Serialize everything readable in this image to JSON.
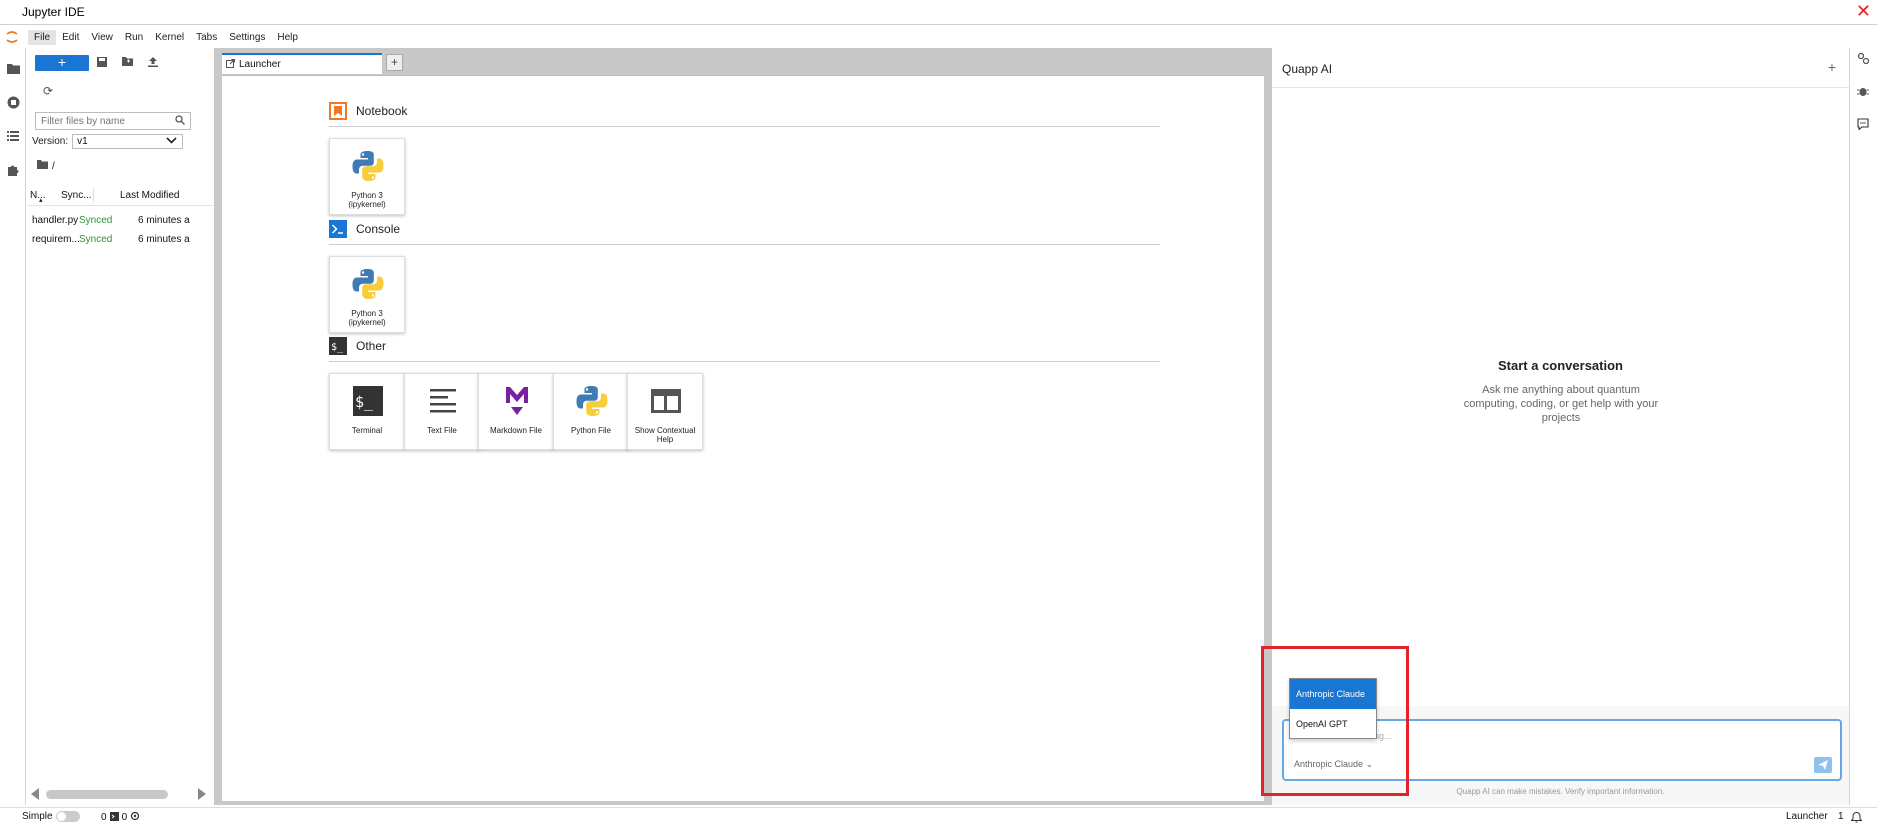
{
  "window": {
    "title": "Jupyter IDE"
  },
  "menu": [
    "File",
    "Edit",
    "View",
    "Run",
    "Kernel",
    "Tabs",
    "Settings",
    "Help"
  ],
  "filebrowser": {
    "new_label": "+",
    "filter_placeholder": "Filter files by name",
    "version_label": "Version:",
    "version_value": "v1",
    "path": "/",
    "columns": {
      "name": "N...",
      "sync": "Sync...",
      "modified": "Last Modified"
    },
    "files": [
      {
        "name": "handler.py",
        "sync": "Synced",
        "modified": "6 minutes a"
      },
      {
        "name": "requirem...",
        "sync": "Synced",
        "modified": "6 minutes a"
      }
    ]
  },
  "tabs": {
    "launcher_label": "Launcher",
    "add_label": "+"
  },
  "launcher": {
    "sections": [
      {
        "title": "Notebook",
        "cards": [
          {
            "label": "Python 3 (ipykernel)",
            "icon": "python-icon"
          }
        ]
      },
      {
        "title": "Console",
        "cards": [
          {
            "label": "Python 3 (ipykernel)",
            "icon": "python-icon"
          }
        ]
      },
      {
        "title": "Other",
        "cards": [
          {
            "label": "Terminal",
            "icon": "terminal-icon"
          },
          {
            "label": "Text File",
            "icon": "text-file-icon"
          },
          {
            "label": "Markdown File",
            "icon": "markdown-icon"
          },
          {
            "label": "Python File",
            "icon": "python-icon"
          },
          {
            "label": "Show Contextual Help",
            "icon": "contextual-help-icon"
          }
        ]
      }
    ]
  },
  "ai": {
    "title": "Quapp AI",
    "add_label": "+",
    "empty_title": "Start a conversation",
    "empty_subtitle": "Ask me anything about quantum computing, coding, or get help with your projects",
    "placeholder_fragment": "ing...",
    "model_selected": "Anthropic Claude",
    "model_options": [
      "Anthropic Claude",
      "OpenAI GPT"
    ],
    "disclaimer": "Quapp AI can make mistakes. Verify important information."
  },
  "status": {
    "mode": "Simple",
    "count_a": "0",
    "count_b": "0",
    "right_label": "Launcher",
    "right_count": "1"
  },
  "colors": {
    "accent": "#1976d2",
    "highlight": "#e0242c",
    "synced": "#388e3c"
  }
}
